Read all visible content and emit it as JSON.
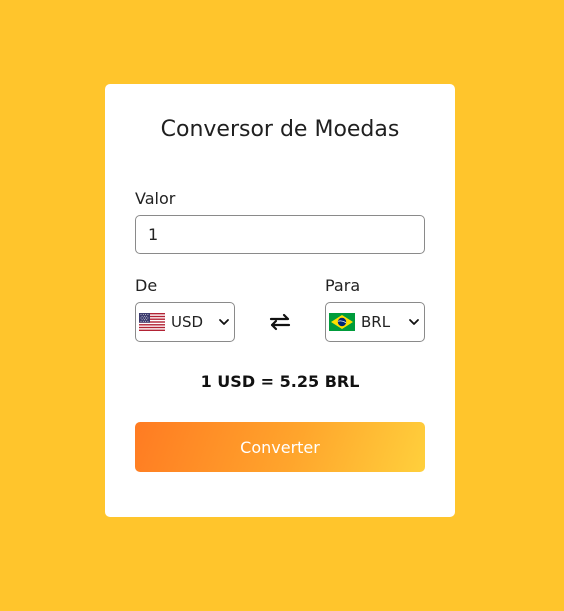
{
  "title": "Conversor de Moedas",
  "amount": {
    "label": "Valor",
    "value": "1"
  },
  "from": {
    "label": "De",
    "currency": "USD",
    "flag_icon": "us-flag-icon"
  },
  "to": {
    "label": "Para",
    "currency": "BRL",
    "flag_icon": "brazil-flag-icon"
  },
  "swap_icon": "swap-arrows-icon",
  "result": "1 USD = 5.25 BRL",
  "convert_label": "Converter",
  "colors": {
    "background": "#FFC52C",
    "card": "#FFFFFF",
    "button_gradient_start": "#FF7B22",
    "button_gradient_end": "#FFD03C"
  }
}
